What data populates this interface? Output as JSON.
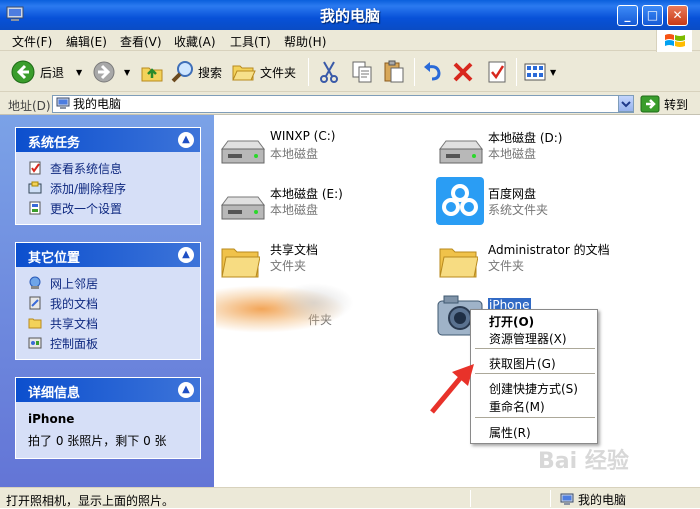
{
  "window": {
    "title": "我的电脑"
  },
  "menu": [
    "文件(F)",
    "编辑(E)",
    "查看(V)",
    "收藏(A)",
    "工具(T)",
    "帮助(H)"
  ],
  "toolbar": {
    "back": "后退",
    "search": "搜索",
    "folders": "文件夹"
  },
  "address": {
    "label": "地址(D)",
    "value": "我的电脑",
    "go": "转到"
  },
  "system_tasks": {
    "title": "系统任务",
    "items": [
      "查看系统信息",
      "添加/删除程序",
      "更改一个设置"
    ]
  },
  "other_places": {
    "title": "其它位置",
    "items": [
      "网上邻居",
      "我的文档",
      "共享文档",
      "控制面板"
    ]
  },
  "details": {
    "title": "详细信息",
    "name": "iPhone",
    "desc": "拍了 0 张照片，剩下 0 张"
  },
  "items": [
    {
      "label": "WINXP (C:)",
      "sub": "本地磁盘"
    },
    {
      "label": "本地磁盘 (D:)",
      "sub": "本地磁盘"
    },
    {
      "label": "本地磁盘 (E:)",
      "sub": "本地磁盘"
    },
    {
      "label": "百度网盘",
      "sub": "系统文件夹"
    },
    {
      "label": "共享文档",
      "sub": "文件夹"
    },
    {
      "label": "Administrator 的文档",
      "sub": "文件夹"
    },
    {
      "label": "",
      "sub": "件夹"
    },
    {
      "label": "iPhone",
      "sub": ""
    }
  ],
  "context_menu": [
    "打开(O)",
    "资源管理器(X)",
    "获取图片(G)",
    "创建快捷方式(S)",
    "重命名(M)",
    "属性(R)"
  ],
  "status": {
    "text": "打开照相机，显示上面的照片。",
    "location": "我的电脑"
  },
  "watermark": "Bai 经验",
  "colors": {
    "titlebar": "#0a5fdc",
    "taskpane": "#7ba2e7",
    "arrow": "#e8322a"
  }
}
